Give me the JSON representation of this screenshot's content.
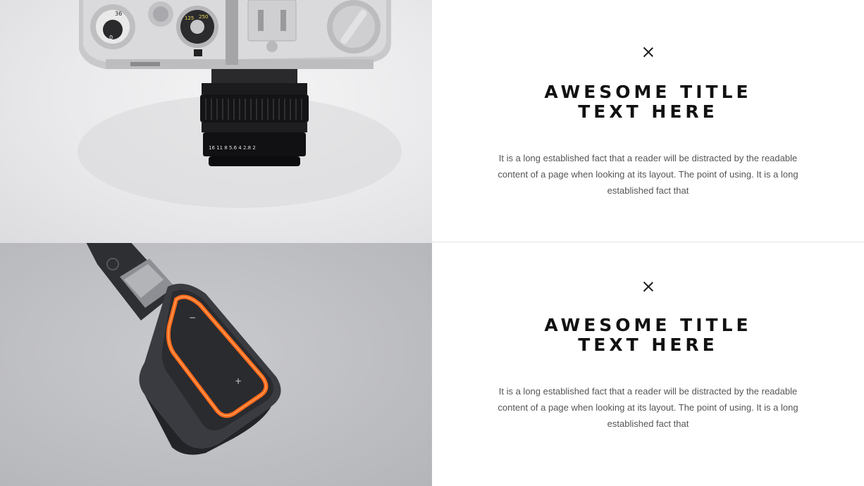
{
  "sections": [
    {
      "image": "camera-photo",
      "close_icon": "close-icon",
      "title_line1": "AWESOME TITLE",
      "title_line2": "TEXT HERE",
      "body": "It is a long established fact that a reader will be distracted by the readable content of a page when looking at its layout. The point of using. It is a long established fact that"
    },
    {
      "image": "device-photo",
      "close_icon": "close-icon",
      "title_line1": "AWESOME TITLE",
      "title_line2": "TEXT HERE",
      "body": "It is a long established fact that a reader will be distracted by the readable content of a page when looking at its layout. The point of using. It is a long established fact that"
    }
  ],
  "colors": {
    "accent_orange": "#ff6a1a",
    "title": "#111111",
    "body": "#555555"
  }
}
